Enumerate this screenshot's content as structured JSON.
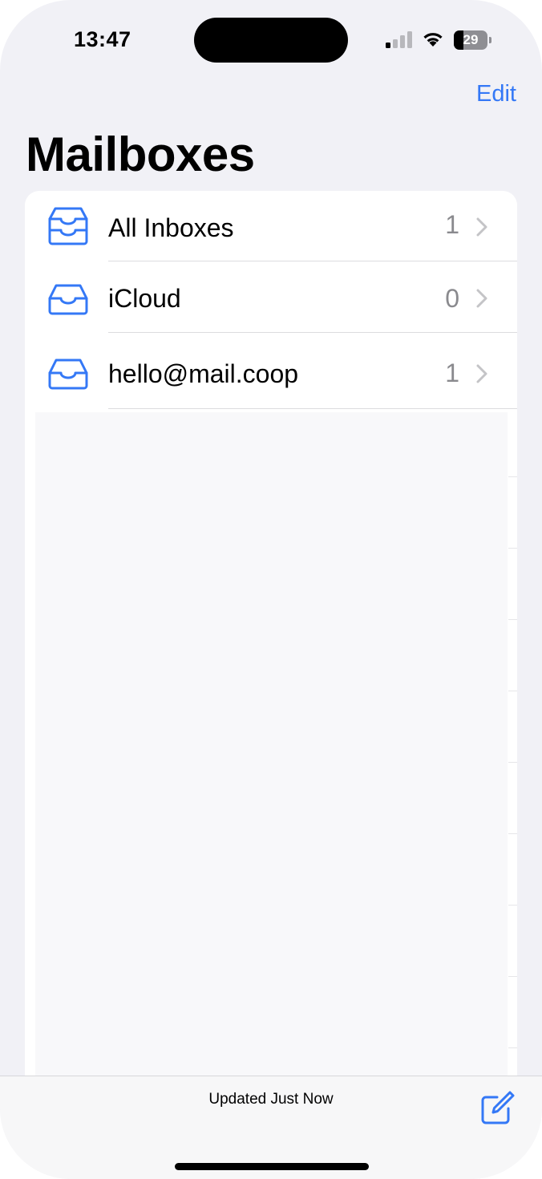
{
  "status_bar": {
    "time": "13:47",
    "battery_level": "29",
    "signal_bars_active": 1,
    "signal_bars_total": 4
  },
  "nav": {
    "edit_label": "Edit",
    "title": "Mailboxes"
  },
  "mailboxes": [
    {
      "label": "All Inboxes",
      "count": "1",
      "icon": "all-inboxes-tray-icon"
    },
    {
      "label": "iCloud",
      "count": "0",
      "icon": "inbox-tray-icon"
    },
    {
      "label": "hello@mail.coop",
      "count": "1",
      "icon": "inbox-tray-icon"
    }
  ],
  "toolbar": {
    "status": "Updated Just Now",
    "compose_icon": "compose-icon"
  },
  "colors": {
    "accent": "#3478f6",
    "background": "#f1f1f6",
    "secondary_text": "#8a8a8e"
  }
}
